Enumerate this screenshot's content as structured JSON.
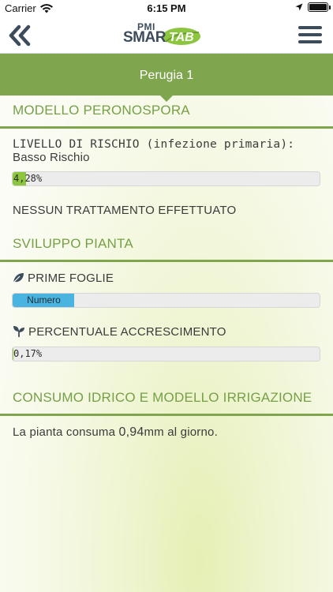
{
  "status_bar": {
    "carrier": "Carrier",
    "time": "6:15 PM"
  },
  "nav": {
    "logo_text_top": "PMI",
    "logo_text_main": "SMAR",
    "logo_text_tab": "TAB",
    "back_icon": "double-chevron-left-icon",
    "menu_icon": "hamburger-menu-icon"
  },
  "location": {
    "name": "Perugia 1"
  },
  "peronospora": {
    "title": "MODELLO PERONOSPORA",
    "risk_label": "LIVELLO DI RISCHIO (infezione primaria):",
    "risk_value": "Basso Rischio",
    "risk_percent_text": "4,28%",
    "risk_fraction": 0.0428,
    "treatment_text": "NESSUN TRATTAMENTO EFFETTUATO"
  },
  "sviluppo": {
    "title": "SVILUPPO PIANTA",
    "prime_foglie_label": "PRIME FOGLIE",
    "prime_foglie_bar_text": "Numero",
    "prime_foglie_fraction": 0.2,
    "accrescimento_label": "PERCENTUALE ACCRESCIMENTO",
    "accrescimento_percent_text": "0,17%",
    "accrescimento_fraction": 0.0017
  },
  "irrigazione": {
    "title": "CONSUMO IDRICO E MODELLO IRRIGAZIONE",
    "text_before": "La pianta consuma ",
    "amount": "0,94",
    "text_after": "mm al giorno."
  },
  "colors": {
    "accent_green": "#7fa54e",
    "risk_fill": "#8cc63f",
    "blue_fill": "#49b4df"
  }
}
